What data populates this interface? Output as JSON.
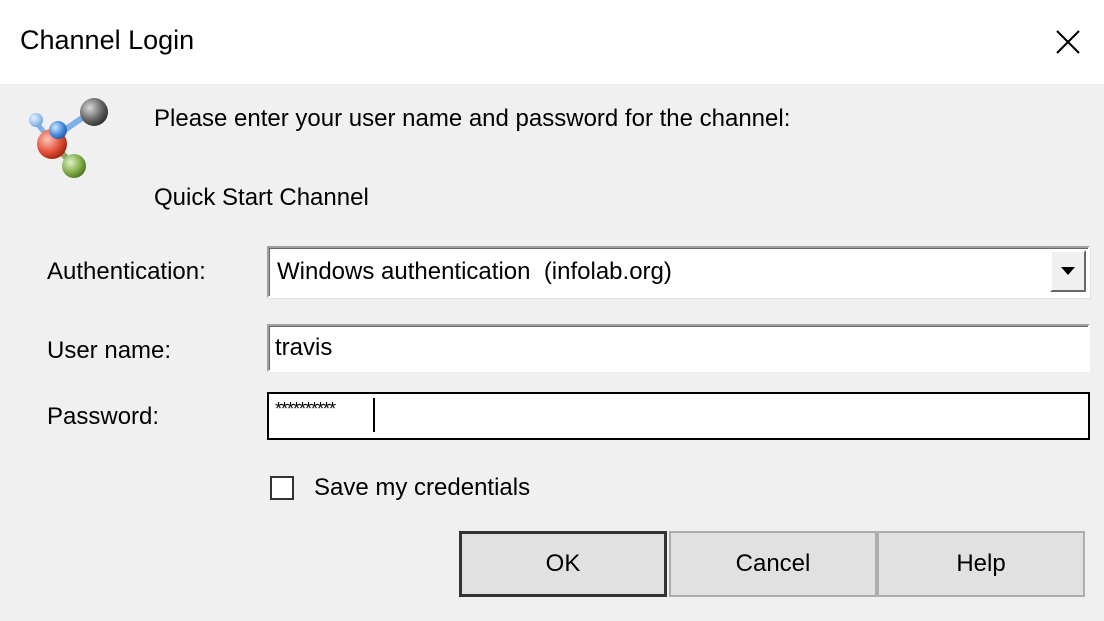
{
  "window": {
    "title": "Channel Login",
    "close_icon": "close-icon"
  },
  "header": {
    "icon": "molecule-icon",
    "prompt": "Please enter your user name and password for the channel:",
    "channel_name": "Quick Start Channel"
  },
  "form": {
    "authentication_label": "Authentication:",
    "authentication_value": "Windows authentication  (infolab.org)",
    "username_label": "User name:",
    "username_value": "travis",
    "password_label": "Password:",
    "password_mask": "**********",
    "save_credentials_label": "Save my credentials",
    "save_credentials_checked": false
  },
  "buttons": {
    "ok": "OK",
    "cancel": "Cancel",
    "help": "Help"
  }
}
